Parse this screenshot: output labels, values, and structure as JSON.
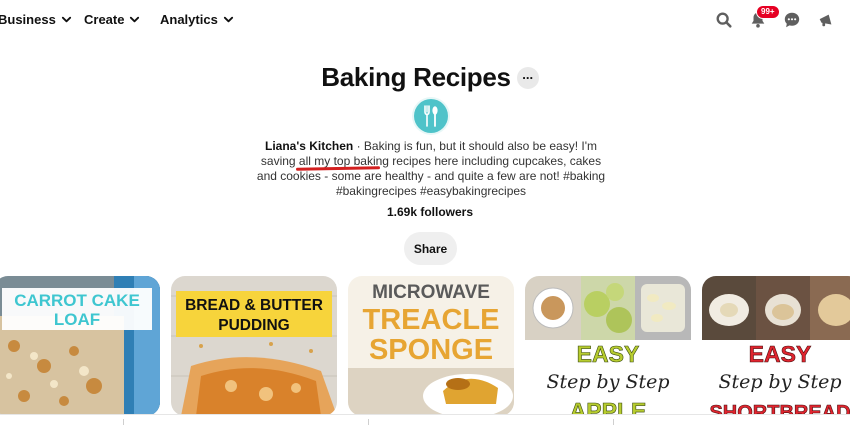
{
  "nav": {
    "items": [
      {
        "label": "Business"
      },
      {
        "label": "Create"
      },
      {
        "label": "Analytics"
      }
    ],
    "notifications_badge": "99+"
  },
  "board": {
    "title": "Baking Recipes",
    "more_label": "...",
    "owner": "Liana's Kitchen",
    "desc_part1": " · Baking is fun, but it should also be easy! I'm saving all my ",
    "desc_highlight": "top baking recipes",
    "desc_part2": " here including cupcakes, cakes and cookies - some are healthy - and quite a few are not! #baking #bakingrecipes #easybakingrecipes",
    "followers": "1.69k followers",
    "share_label": "Share"
  },
  "pins": [
    {
      "line1": "CARROT CAKE",
      "line2": "LOAF"
    },
    {
      "line1": "BREAD & BUTTER",
      "line2": "PUDDING"
    },
    {
      "line1": "MICROWAVE",
      "line2": "TREACLE",
      "line3": "SPONGE"
    },
    {
      "line1": "EASY",
      "line2": "Step by Step",
      "line3": "APPLE"
    },
    {
      "line1": "EASY",
      "line2": "Step by Step",
      "line3": "SHORTBREAD"
    }
  ],
  "colors": {
    "notification_red": "#e60023",
    "avatar_teal": "#4fc3c9",
    "underline_red": "#d32020"
  },
  "icons": [
    "chevron-down-icon",
    "search-icon",
    "bell-icon",
    "chat-icon",
    "megaphone-icon",
    "fork-spoon-icon"
  ]
}
